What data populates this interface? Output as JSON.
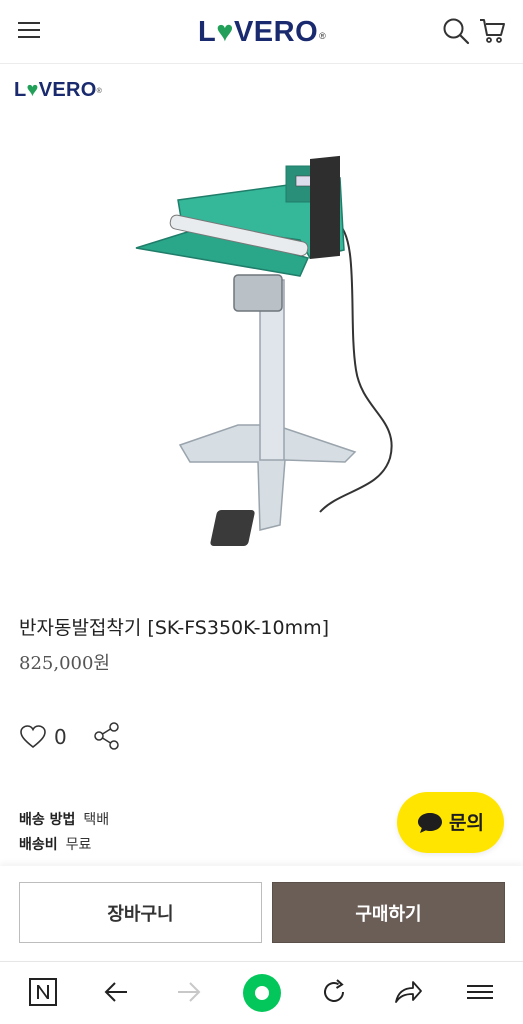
{
  "header": {
    "brand_pre": "L",
    "brand_heart": "♥",
    "brand_post": "VERO",
    "brand_mark": "®",
    "menu_icon": "hamburger-icon",
    "search_icon": "search-icon",
    "cart_icon": "cart-icon"
  },
  "brand_logo": {
    "pre": "L",
    "heart": "♥",
    "post": "VERO",
    "mark": "®"
  },
  "product": {
    "image_name": "half-automatic-foot-sealer",
    "title": "반자동발접착기 [SK-FS350K-10mm]",
    "price": "825,000원",
    "like_count": "0"
  },
  "shipping": {
    "method_label": "배송 방법",
    "method_value": "택배",
    "fee_label": "배송비",
    "fee_value": "무료"
  },
  "inquiry": {
    "label": "문의",
    "icon": "chat-bubble-icon"
  },
  "buy_bar": {
    "cart_label": "장바구니",
    "buy_label": "구매하기"
  },
  "colors": {
    "brand_navy": "#1a2a6e",
    "brand_green": "#22a05a",
    "inquiry_yellow": "#ffe500",
    "buy_brown": "#6b5e57",
    "naver_green": "#03c75a"
  },
  "browser_nav": {
    "icons": [
      "naver-home-icon",
      "back-arrow-icon",
      "forward-arrow-icon",
      "green-dot-icon",
      "reload-icon",
      "share-arrow-icon",
      "menu-icon"
    ]
  }
}
